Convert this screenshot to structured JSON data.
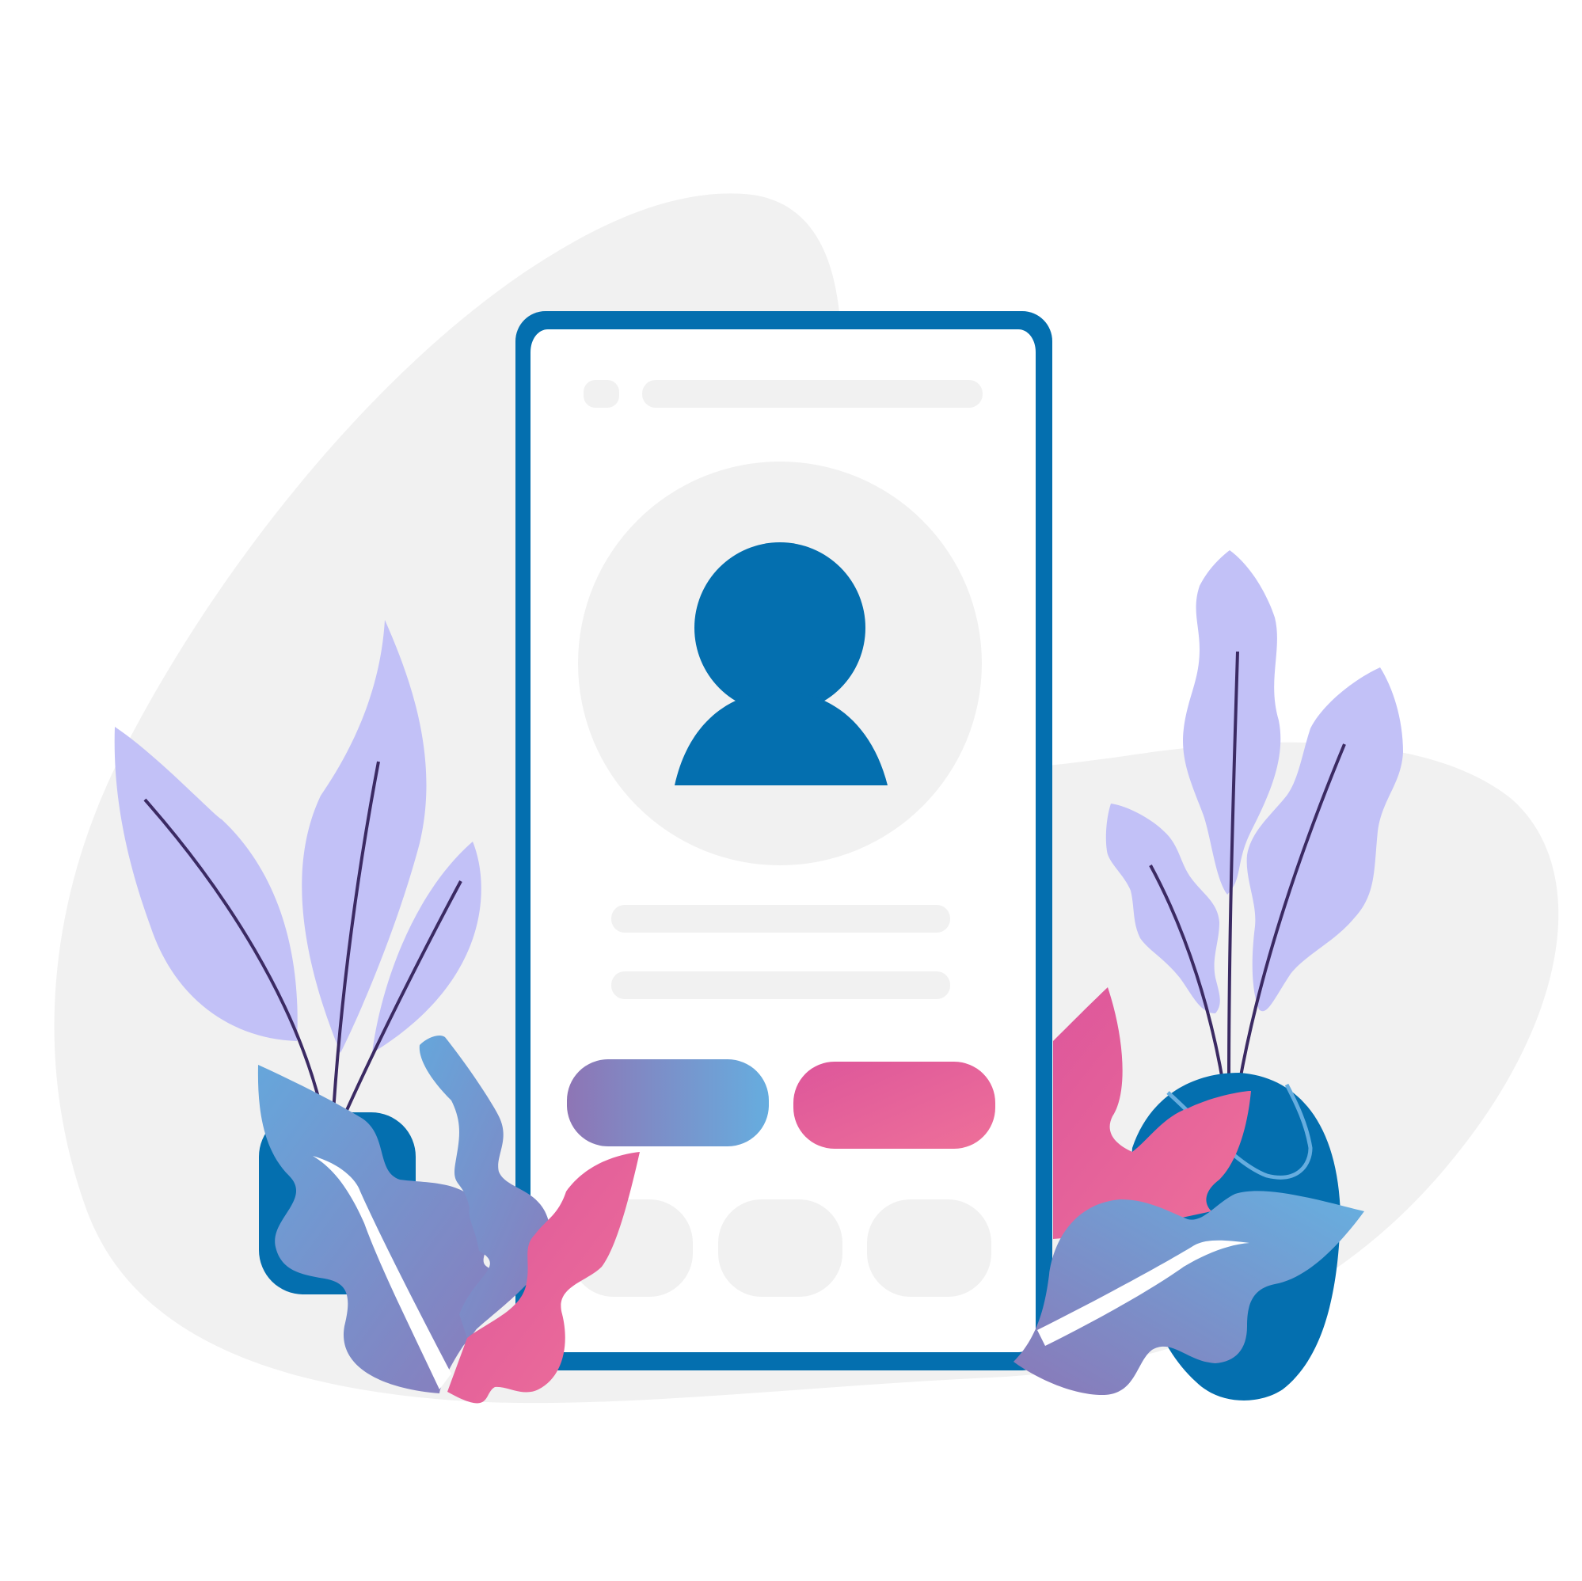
{
  "illustration": {
    "subject": "user-profile-on-phone",
    "profile_screen": {
      "avatar": "user-silhouette-icon",
      "menu": "menu-icon",
      "buttons": [
        {
          "name": "primary-action-button",
          "color": "gradient-purple-blue"
        },
        {
          "name": "secondary-action-button",
          "color": "gradient-pink"
        }
      ],
      "icon_tiles": 3,
      "text_lines": 3
    },
    "colors": {
      "background_blob": "#f1f1f1",
      "phone_frame": "#046faf",
      "phone_screen": "#ffffff",
      "placeholder": "#f1f1f1",
      "avatar_icon": "#046faf",
      "leaf_lavender": "#c2c1f7",
      "leaf_stem": "#3b2a63",
      "gradient_purple": "#8e75b5",
      "gradient_blue": "#66addf",
      "gradient_pink_dark": "#dd569b",
      "gradient_pink_light": "#ee7099",
      "pot_blue": "#046faf"
    }
  }
}
